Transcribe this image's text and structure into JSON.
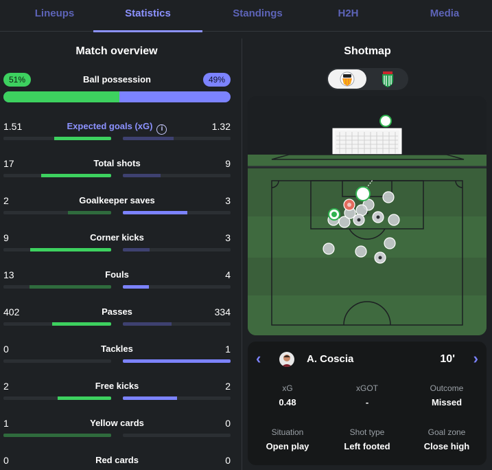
{
  "tabs": [
    {
      "label": "Lineups"
    },
    {
      "label": "Statistics"
    },
    {
      "label": "Standings"
    },
    {
      "label": "H2H"
    },
    {
      "label": "Media"
    }
  ],
  "active_tab": "Statistics",
  "match_overview": {
    "title": "Match overview",
    "possession": {
      "label": "Ball possession",
      "home_text": "51%",
      "away_text": "49%",
      "home_fraction": 0.51
    },
    "stats": [
      {
        "label": "Expected goals (xG)",
        "home": "1.51",
        "away": "1.32",
        "home_fraction": 0.53,
        "away_fraction": 0.47,
        "accent": true
      },
      {
        "label": "Total shots",
        "home": "17",
        "away": "9",
        "home_fraction": 0.65,
        "away_fraction": 0.35
      },
      {
        "label": "Goalkeeper saves",
        "home": "2",
        "away": "3",
        "home_fraction": 0.4,
        "away_fraction": 0.6
      },
      {
        "label": "Corner kicks",
        "home": "9",
        "away": "3",
        "home_fraction": 0.75,
        "away_fraction": 0.25
      },
      {
        "label": "Fouls",
        "home": "13",
        "away": "4",
        "home_fraction": 0.76,
        "away_fraction": 0.24
      },
      {
        "label": "Passes",
        "home": "402",
        "away": "334",
        "home_fraction": 0.55,
        "away_fraction": 0.45
      },
      {
        "label": "Tackles",
        "home": "0",
        "away": "1",
        "home_fraction": 0.0,
        "away_fraction": 1.0
      },
      {
        "label": "Free kicks",
        "home": "2",
        "away": "2",
        "home_fraction": 0.5,
        "away_fraction": 0.5
      },
      {
        "label": "Yellow cards",
        "home": "1",
        "away": "0",
        "home_fraction": 1.0,
        "away_fraction": 0.0
      },
      {
        "label": "Red cards",
        "home": "0",
        "away": "0",
        "home_fraction": 0.0,
        "away_fraction": 0.0
      }
    ]
  },
  "shotmap": {
    "title": "Shotmap",
    "selected_team": "home",
    "shot_detail": {
      "player": "A. Coscia",
      "minute": "10'",
      "fields": [
        {
          "key": "xG",
          "value": "0.48"
        },
        {
          "key": "xGOT",
          "value": "-"
        },
        {
          "key": "Outcome",
          "value": "Missed"
        },
        {
          "key": "Situation",
          "value": "Open play"
        },
        {
          "key": "Shot type",
          "value": "Left footed"
        },
        {
          "key": "Goal zone",
          "value": "Close high"
        }
      ]
    }
  },
  "colors": {
    "home": "#3dd15f",
    "away": "#7c83ff",
    "home_dim": "#2f6b3d",
    "away_dim": "#3e4170",
    "accent": "#8c92ff",
    "pitch": "#3f6b3f"
  },
  "icons": [
    "info-icon",
    "chevron-left-icon",
    "chevron-right-icon",
    "home-team-crest-icon",
    "away-team-crest-icon"
  ]
}
